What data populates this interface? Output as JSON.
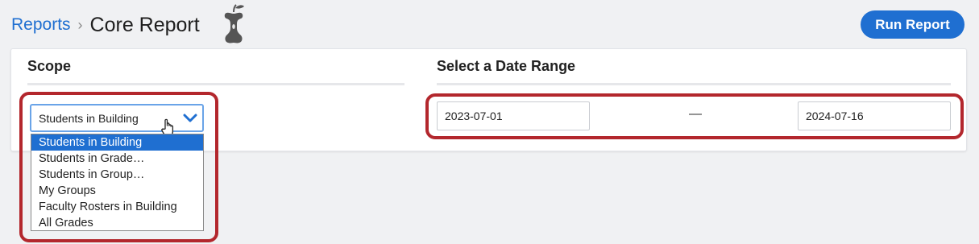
{
  "breadcrumb": {
    "parent": "Reports",
    "separator": "›",
    "current": "Core Report"
  },
  "logo": {
    "icon": "apple-core-icon"
  },
  "toolbar": {
    "run_label": "Run Report"
  },
  "scope": {
    "title": "Scope",
    "selected": "Students in Building",
    "options": [
      "Students in Building",
      "Students in Grade…",
      "Students in Group…",
      "My Groups",
      "Faculty Rosters in Building",
      "All Grades"
    ],
    "active_index": 0
  },
  "date_range": {
    "title": "Select a Date Range",
    "start": "2023-07-01",
    "separator": "—",
    "end": "2024-07-16"
  },
  "colors": {
    "accent": "#1f6fd1",
    "highlight": "#b3272d",
    "focus": "#6aa4e8"
  }
}
